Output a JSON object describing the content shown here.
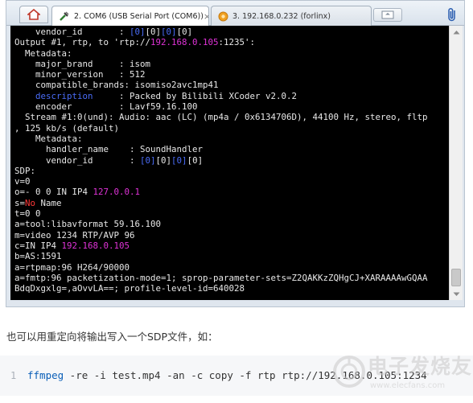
{
  "tabs": [
    {
      "label": "2. COM6  (USB Serial Port (COM6))",
      "close": "×"
    },
    {
      "label": "3. 192.168.0.232 (forlinx)"
    }
  ],
  "terminal_lines": [
    [
      {
        "t": "    vendor_id       : "
      },
      {
        "t": "[0]",
        "c": "blue"
      },
      {
        "t": "[0]"
      },
      {
        "t": "[0]",
        "c": "blue"
      },
      {
        "t": "[0]"
      }
    ],
    [
      {
        "t": "Output #1, rtp, to 'rtp://"
      },
      {
        "t": "192.168.0.105",
        "c": "mag"
      },
      {
        "t": ":1235':"
      }
    ],
    [
      {
        "t": "  Metadata:"
      }
    ],
    [
      {
        "t": "    major_brand     : isom"
      }
    ],
    [
      {
        "t": "    minor_version   : 512"
      }
    ],
    [
      {
        "t": "    compatible_brands: isomiso2avc1mp41"
      }
    ],
    [
      {
        "t": "    "
      },
      {
        "t": "description",
        "c": "blue"
      },
      {
        "t": "     : Packed by Bilibili XCoder v2.0.2"
      }
    ],
    [
      {
        "t": "    encoder         : Lavf59.16.100"
      }
    ],
    [
      {
        "t": "  Stream #1:0(und): Audio: aac (LC) (mp4a / 0x6134706D), 44100 Hz, stereo, fltp"
      }
    ],
    [
      {
        "t": ", 125 kb/s (default)"
      }
    ],
    [
      {
        "t": "    Metadata:"
      }
    ],
    [
      {
        "t": "      handler_name    : SoundHandler"
      }
    ],
    [
      {
        "t": "      vendor_id       : "
      },
      {
        "t": "[0]",
        "c": "blue"
      },
      {
        "t": "[0]"
      },
      {
        "t": "[0]",
        "c": "blue"
      },
      {
        "t": "[0]"
      }
    ],
    [
      {
        "t": "SDP:"
      }
    ],
    [
      {
        "t": "v=0"
      }
    ],
    [
      {
        "t": "o=- 0 0 IN IP4 "
      },
      {
        "t": "127.0.0.1",
        "c": "mag"
      }
    ],
    [
      {
        "t": "s="
      },
      {
        "t": "No",
        "c": "red"
      },
      {
        "t": " Name"
      }
    ],
    [
      {
        "t": "t=0 0"
      }
    ],
    [
      {
        "t": "a=tool:libavformat 59.16.100"
      }
    ],
    [
      {
        "t": "m=video 1234 RTP/AVP 96"
      }
    ],
    [
      {
        "t": "c=IN IP4 "
      },
      {
        "t": "192.168.0.105",
        "c": "mag"
      }
    ],
    [
      {
        "t": "b=AS:1591"
      }
    ],
    [
      {
        "t": "a=rtpmap:96 H264/90000"
      }
    ],
    [
      {
        "t": "a=fmtp:96 packetization-mode=1; sprop-parameter-sets=Z2QAKKzZQHgCJ+XARAAAAwGQAA"
      }
    ],
    [
      {
        "t": "BdqDxgxlg=,aOvvLA==; profile-level-id=640028"
      }
    ]
  ],
  "paragraph": "也可以用重定向将输出写入一个SDP文件，如：",
  "code": {
    "line_number": "1",
    "keyword": "ffmpeg",
    "rest": " -re -i test.mp4 -an -c copy -f rtp rtp://192.168.0.105:1234"
  },
  "watermark": {
    "text": "电子发烧友",
    "url": "www.elecfans.com"
  },
  "colors": {
    "terminal_bg": "#000000",
    "terminal_text": "#e8e8e8",
    "highlight_blue": "#4a6cf7",
    "highlight_magenta": "#e033d8",
    "highlight_red": "#ff3838",
    "code_keyword": "#0b5fb8"
  }
}
